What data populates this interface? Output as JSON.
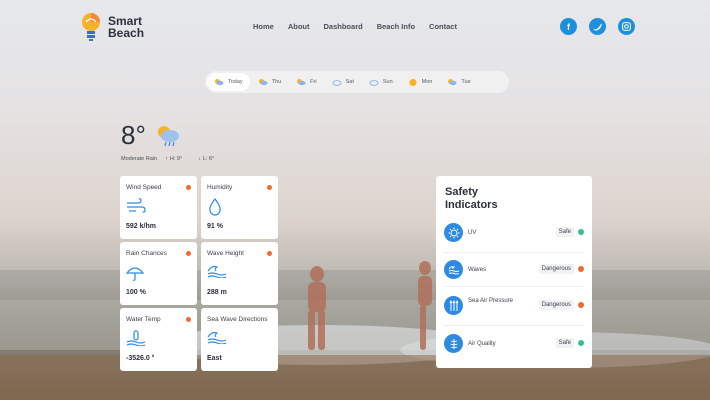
{
  "brand": {
    "line1": "Smart",
    "line2": "Beach"
  },
  "nav": [
    {
      "label": "Home"
    },
    {
      "label": "About"
    },
    {
      "label": "Dashboard"
    },
    {
      "label": "Beach Info"
    },
    {
      "label": "Contact"
    }
  ],
  "socials": [
    {
      "icon": "facebook-icon",
      "glyph": "f"
    },
    {
      "icon": "twitter-icon",
      "glyph": "t"
    },
    {
      "icon": "instagram-icon",
      "glyph": "◎"
    }
  ],
  "days": [
    {
      "label": "Today",
      "icon": "cloud-sun-rain-icon",
      "active": true
    },
    {
      "label": "Thu",
      "icon": "cloud-sun-rain-icon"
    },
    {
      "label": "Fri",
      "icon": "cloud-sun-rain-icon"
    },
    {
      "label": "Sat",
      "icon": "cloud-icon"
    },
    {
      "label": "Sun",
      "icon": "cloud-icon"
    },
    {
      "label": "Mon",
      "icon": "sun-icon"
    },
    {
      "label": "Tue",
      "icon": "cloud-sun-rain-icon"
    }
  ],
  "current": {
    "temperature": "8°",
    "condition": "Moderate Rain",
    "high": "H: 9°",
    "low": "L: 6°"
  },
  "cards": [
    {
      "title": "Wind Speed",
      "value": "592 k/hm",
      "icon": "wind-icon",
      "dot": true
    },
    {
      "title": "Humidity",
      "value": "91 %",
      "icon": "droplet-icon",
      "dot": true
    },
    {
      "title": "Rain Chances",
      "value": "100 %",
      "icon": "umbrella-icon",
      "dot": true
    },
    {
      "title": "Wave Height",
      "value": "288 m",
      "icon": "wave-icon",
      "dot": true
    },
    {
      "title": "Water Temp",
      "value": "-3526.0 °",
      "icon": "water-temp-icon",
      "dot": true
    },
    {
      "title": "Sea Wave Directions",
      "value": "East",
      "icon": "wave-icon",
      "dot": false
    }
  ],
  "safety": {
    "title": "Safety Indicators",
    "items": [
      {
        "label": "UV",
        "status": "Safe",
        "status_color": "#36c08a",
        "icon": "sun-gear-icon"
      },
      {
        "label": "Waves",
        "status": "Dangerous",
        "status_color": "#ef6a2c",
        "icon": "waves-icon"
      },
      {
        "label": "Sea Air Pressure",
        "status": "Dangerous",
        "status_color": "#ef6a2c",
        "icon": "pressure-icon"
      },
      {
        "label": "Air Quality",
        "status": "Safe",
        "status_color": "#36c08a",
        "icon": "air-quality-icon"
      }
    ]
  },
  "colors": {
    "accent": "#2d8ae0",
    "danger": "#ef6a2c",
    "safe": "#36c08a"
  }
}
